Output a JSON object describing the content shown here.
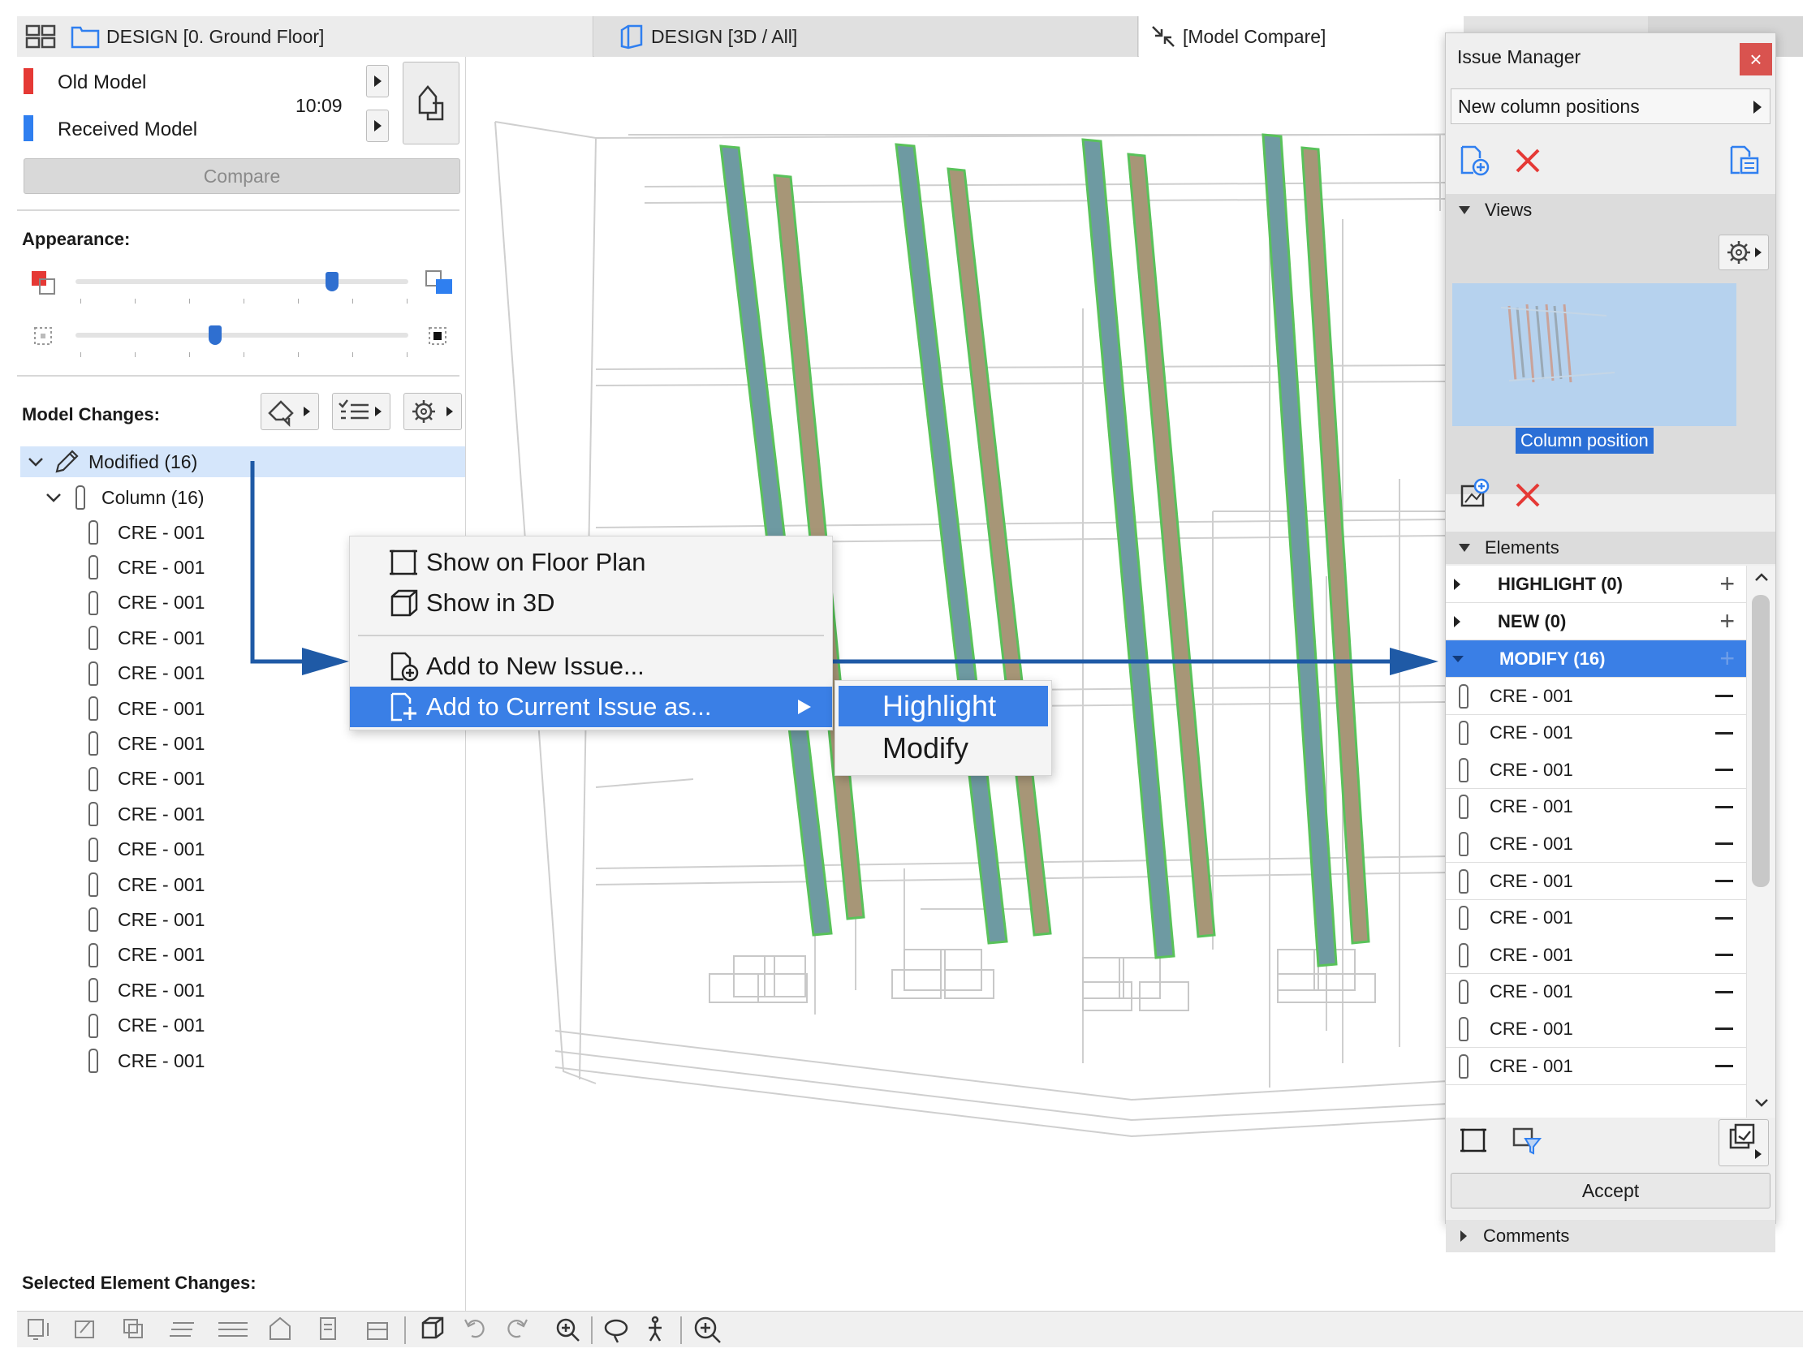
{
  "tabs": [
    {
      "label": "DESIGN [0. Ground Floor]"
    },
    {
      "label": "DESIGN [3D / All]"
    },
    {
      "label": "[Model Compare]"
    }
  ],
  "compare": {
    "old_model": "Old Model",
    "received_model": "Received Model",
    "time": "10:09",
    "old_color": "#e53935",
    "received_color": "#2f7ff0",
    "compare_button": "Compare"
  },
  "appearance": {
    "title": "Appearance:",
    "slider1_value": 0.77,
    "slider2_value": 0.42
  },
  "model_changes": {
    "title": "Model Changes:",
    "modified_label": "Modified (16)",
    "column_label": "Column (16)",
    "items": [
      "CRE - 001",
      "CRE - 001",
      "CRE - 001",
      "CRE - 001",
      "CRE - 001",
      "CRE - 001",
      "CRE - 001",
      "CRE - 001",
      "CRE - 001",
      "CRE - 001",
      "CRE - 001",
      "CRE - 001",
      "CRE - 001",
      "CRE - 001",
      "CRE - 001",
      "CRE - 001"
    ]
  },
  "selected_changes": {
    "title": "Selected Element Changes:"
  },
  "context_menu": {
    "show_floor_plan": "Show on Floor Plan",
    "show_3d": "Show in 3D",
    "add_new_issue": "Add to New Issue...",
    "add_current_issue": "Add to Current Issue as..."
  },
  "submenu": {
    "highlight": "Highlight",
    "modify": "Modify"
  },
  "issue_manager": {
    "title": "Issue Manager",
    "close": "×",
    "issue_name": "New column positions",
    "views_header": "Views",
    "view_caption": "Column position",
    "elements_header": "Elements",
    "highlight_group": "HIGHLIGHT (0)",
    "new_group": "NEW (0)",
    "modify_group": "MODIFY (16)",
    "elements": [
      "CRE - 001",
      "CRE - 001",
      "CRE - 001",
      "CRE - 001",
      "CRE - 001",
      "CRE - 001",
      "CRE - 001",
      "CRE - 001",
      "CRE - 001",
      "CRE - 001",
      "CRE - 001"
    ],
    "accept_button": "Accept",
    "comments_header": "Comments",
    "accent": "#3a7fe6"
  }
}
